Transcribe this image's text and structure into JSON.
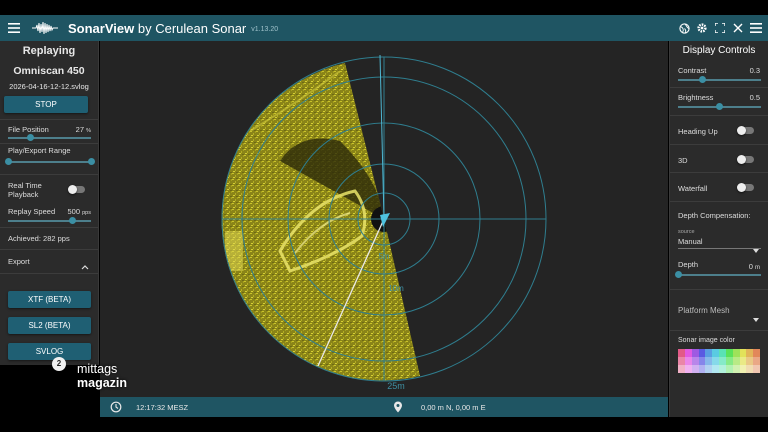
{
  "app": {
    "title": "SonarView",
    "by": "by Cerulean Sonar",
    "version": "v1.13.20"
  },
  "replay": {
    "title": "Replaying",
    "device": "Omniscan 450",
    "file": "2026-04-16-12-12.svlog",
    "stop_label": "STOP",
    "file_position_label": "File Position",
    "file_position_value": "27",
    "file_position_unit": "%",
    "file_position_fraction": 0.27,
    "range_label": "Play/Export Range",
    "realtime_label_line1": "Real Time",
    "realtime_label_line2": "Playback",
    "realtime_on": false,
    "speed_label": "Replay Speed",
    "speed_value": "500",
    "speed_unit": "pps",
    "speed_fraction": 0.78,
    "achieved": "Achieved: 282 pps"
  },
  "export": {
    "title": "Export",
    "buttons": [
      "XTF (BETA)",
      "SL2 (BETA)",
      "SVLOG"
    ]
  },
  "display": {
    "title": "Display Controls",
    "contrast_label": "Contrast",
    "contrast_value": "0.3",
    "contrast_fraction": 0.3,
    "brightness_label": "Brightness",
    "brightness_value": "0.5",
    "brightness_fraction": 0.5,
    "heading_up_label": "Heading Up",
    "three_d_label": "3D",
    "waterfall_label": "Waterfall",
    "depth_comp_label": "Depth Compensation:",
    "source_label": "source",
    "source_value": "Manual",
    "depth_label": "Depth",
    "depth_value": "0",
    "depth_unit": "m",
    "depth_fraction": 0,
    "platform_mesh_label": "Platform Mesh",
    "sonar_color_label": "Sonar image color"
  },
  "sonar_view": {
    "range_labels": [
      "5m",
      "10m",
      "25m"
    ]
  },
  "status": {
    "time": "12:17:32 MESZ",
    "coordinates": "0,00 m N, 0,00 m E"
  },
  "watermark": {
    "line1": "mittags",
    "line2": "magazin",
    "badge": "2"
  },
  "colors": {
    "accent": "#1f5563",
    "button": "#1f5f73",
    "panel": "#2b2b2b",
    "sonar_yellow": "#c8c22a",
    "ring": "#2f7e8f"
  }
}
